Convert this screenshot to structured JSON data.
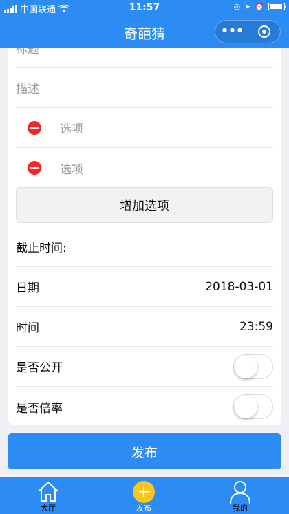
{
  "status_bar": {
    "carrier": "中国联通",
    "time": "11:57"
  },
  "nav": {
    "title": "奇葩猜"
  },
  "form": {
    "title_placeholder": "标题",
    "desc_placeholder": "描述",
    "options": [
      {
        "placeholder": "选项"
      },
      {
        "placeholder": "选项"
      }
    ],
    "add_option_label": "增加选项",
    "deadline_label": "截止时间:",
    "date_label": "日期",
    "date_value": "2018-03-01",
    "time_label": "时间",
    "time_value": "23:59",
    "public_label": "是否公开",
    "public_on": false,
    "multiplier_label": "是否倍率",
    "multiplier_on": false
  },
  "publish_label": "发布",
  "tabbar": {
    "items": [
      {
        "label": "大厅",
        "icon": "home-icon",
        "active": false
      },
      {
        "label": "发布",
        "icon": "plus-icon",
        "active": true
      },
      {
        "label": "我的",
        "icon": "person-icon",
        "active": false
      }
    ]
  },
  "colors": {
    "primary": "#2c8cf4",
    "accent": "#f8c61d",
    "danger": "#ff2222"
  }
}
